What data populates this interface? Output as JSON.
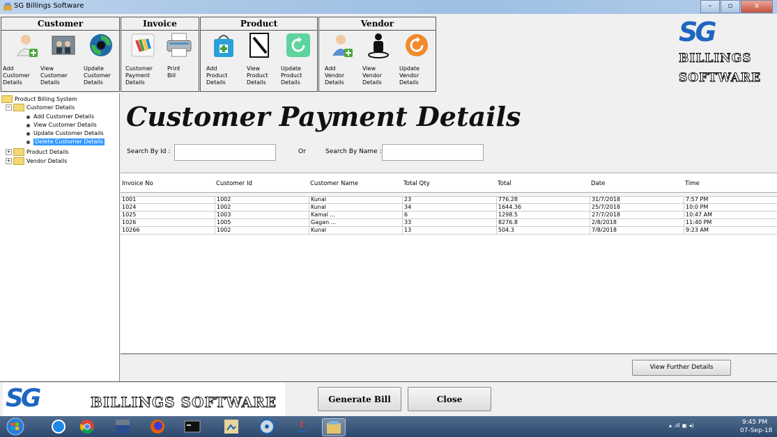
{
  "window": {
    "title": "SG Billings Software",
    "buttons": [
      "–",
      "▫",
      "x"
    ]
  },
  "toolbar": {
    "customer": {
      "title": "Customer",
      "items": [
        "Add\nCustomer\nDetails",
        "View\nCustomer\nDetails",
        "Update\nCustomer\nDetails"
      ]
    },
    "invoice": {
      "title": "Invoice",
      "items": [
        "Customer\nPayment\nDetails",
        "Print\nBill"
      ]
    },
    "product": {
      "title": "Product",
      "items": [
        "Add\nProduct\nDetails",
        "View\nProduct\nDetails",
        "Update\nProduct\nDetails"
      ]
    },
    "vendor": {
      "title": "Vendor",
      "items": [
        "Add\nVendor\nDetails",
        "View\nVendor\nDetails",
        "Update\nVendor\nDetails"
      ]
    }
  },
  "logo": {
    "sg": "SG",
    "line1": "BILLINGS",
    "line2": "SOFTWARE",
    "footer_text": "BILLINGS SOFTWARE"
  },
  "tree": {
    "root": "Product Billing System",
    "customer": "Customer Details",
    "customer_children": [
      "Add Customer Details",
      "View Customer Details",
      "Update Customer Details",
      "Delete Customer Details"
    ],
    "product": "Product Details",
    "vendor": "Vendor Details",
    "expand_minus": "−",
    "expand_plus": "+"
  },
  "main": {
    "heading": "Customer Payment Details",
    "search_id_label": "Search By Id :",
    "or_label": "Or",
    "search_name_label": "Search By Name :",
    "search_id_value": "",
    "search_name_value": ""
  },
  "table": {
    "columns": [
      "Invoice No",
      "Customer Id",
      "Customer Name",
      "Total Qty",
      "Total",
      "Date",
      "Time"
    ],
    "rows": [
      [
        "1001",
        "1002",
        "Kunal",
        "23",
        "776.28",
        "31/7/2018",
        "7:57 PM"
      ],
      [
        "1024",
        "1002",
        "Kunal",
        "34",
        "1644.36",
        "25/7/2018",
        "10:0 PM"
      ],
      [
        "1025",
        "1003",
        "Kamal       ...",
        "6",
        "1298.5",
        "27/7/2018",
        "10:47 AM"
      ],
      [
        "1026",
        "1005",
        "Gagan       ...",
        "33",
        "8276.8",
        "2/8/2018",
        "11:40 PM"
      ],
      [
        "10266",
        "1002",
        "Kunal",
        "13",
        "504.3",
        "7/8/2018",
        "9:23 AM"
      ]
    ]
  },
  "buttons": {
    "view_further": "View Further Details",
    "generate_bill": "Generate Bill",
    "close": "Close"
  },
  "taskbar": {
    "time": "9:45 PM",
    "date": "07-Sep-18",
    "tray_glyphs": "▴  .ıll  ▣  ◂)"
  },
  "colors": {
    "selection": "#3399ff",
    "taskbar": "#2c486c"
  }
}
